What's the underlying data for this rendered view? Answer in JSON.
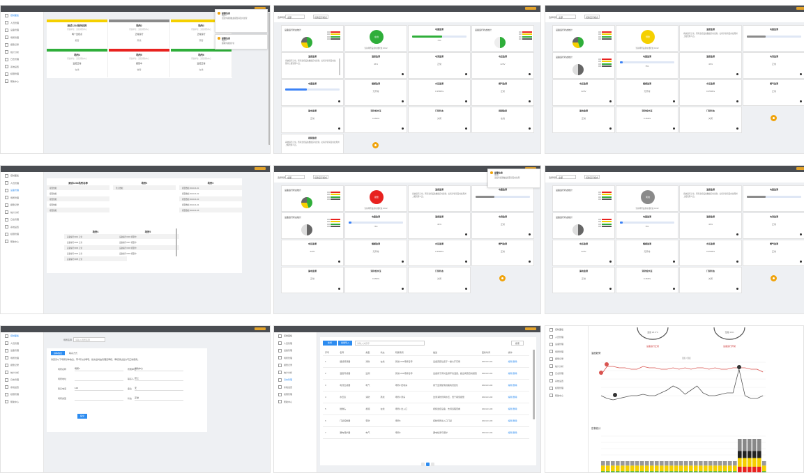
{
  "sidebar_items": [
    "控制面板",
    "人员管理",
    "设备管理",
    "场所管理",
    "报警记录",
    "统计分析",
    "日志管理",
    "系统设置",
    "权限管理",
    "帮助中心"
  ],
  "toolbar": {
    "filter_label": "选择场所",
    "filter_value": "全部",
    "filter_button": "切换显示模式"
  },
  "panel1": {
    "cards": [
      {
        "title": "测试1234场所名称",
        "status": "yellow",
        "sub": "所属单位：某某消防中心",
        "val1": "两个监控点",
        "val2": "报警"
      },
      {
        "title": "场所2",
        "status": "gray",
        "sub": "所属单位：某某消防中心",
        "val1": "正常运行",
        "val2": "离线"
      },
      {
        "title": "场所3",
        "status": "yellow",
        "sub": "所属单位：某某消防中心",
        "val1": "正常运行",
        "val2": "预警"
      },
      {
        "title": "场所4",
        "status": "green",
        "sub": "所属单位：某某消防中心",
        "val1": "监控正常",
        "val2": "在线"
      },
      {
        "title": "场所5",
        "status": "red",
        "sub": "所属单位：某某消防中心",
        "val1": "报警中",
        "val2": "告警"
      },
      {
        "title": "场所6",
        "status": "green",
        "sub": "所属单位：某某消防中心",
        "val1": "监控正常",
        "val2": "在线"
      }
    ],
    "notices": [
      {
        "title": "报警信息",
        "body": "场所1\n温度传感器触发报警请及时处理"
      },
      {
        "title": "报警信息",
        "body": "场所5\n烟雾传感器异常"
      }
    ]
  },
  "dash": {
    "pie_title": "设备运行状态统计",
    "legend": [
      "在线",
      "离线",
      "报警",
      "预警"
    ],
    "circle_label_green": "在线",
    "circle_label_yellow": "预警",
    "circle_label_red": "报警",
    "circle_label_gray": "离线",
    "circle_caption": "当前场所设备在线状态 10/12",
    "progress_title": "电量监测",
    "progress_val": "75%",
    "cells": [
      {
        "title": "温度监测",
        "val": "25.6°C"
      },
      {
        "title": "湿度监测",
        "val": "46%"
      },
      {
        "title": "电流监测",
        "val": "正常"
      },
      {
        "title": "电压监测",
        "val": "220V"
      },
      {
        "title": "烟感监测",
        "val": "无异常"
      },
      {
        "title": "水压监测",
        "val": "0.35MPa"
      },
      {
        "title": "燃气监测",
        "val": "正常"
      },
      {
        "title": "漏电监测",
        "val": "正常"
      },
      {
        "title": "消防栓水压",
        "val": "0.4MPa"
      },
      {
        "title": "门禁状态",
        "val": "关闭"
      },
      {
        "title": "视频监控",
        "val": "在线"
      }
    ],
    "desc": "系统运行正常，所有监控设备数据实时更新，如有异常请及时处理并上报管理人员。"
  },
  "panel4": {
    "cards": [
      {
        "title": "测试1234场所名称",
        "rows": [
          "报警数据",
          "报警数据",
          "报警数据",
          "报警数据",
          "报警数据"
        ]
      },
      {
        "title": "场所2",
        "rows": [
          "暂无数据"
        ]
      },
      {
        "title": "场所3",
        "rows": [
          "报警数据 2024-01-01",
          "报警数据 2024-01-02",
          "报警数据 2024-01-03",
          "报警数据 2024-01-04",
          "报警数据 2024-01-05"
        ]
      },
      {
        "title": "场所4",
        "rows": [
          "设备编号0001 正常",
          "设备编号0002 正常",
          "设备编号0003 正常",
          "设备编号0004 正常",
          "设备编号0005 正常"
        ]
      },
      {
        "title": "场所5",
        "rows": [
          "设备编号0006 报警中",
          "设备编号0007 报警中",
          "设备编号0008 报警中",
          "设备编号0009 报警中"
        ]
      }
    ]
  },
  "panel7": {
    "search_label": "场所名称",
    "search_placeholder": "请输入场所名称",
    "tabs": [
      "基本信息",
      "联系方式"
    ],
    "note": "请完善以下场所基本信息，带*号为必填项，提交后将由管理员审核，审核通过后方可正常使用。",
    "rows": [
      {
        "k": "场所名称",
        "v": "场所1",
        "k2": "所属单位",
        "v2": "消防中心"
      },
      {
        "k": "场所地址",
        "v": "",
        "k2": "联系人",
        "v2": "张三"
      },
      {
        "k": "联系电话",
        "v": "123",
        "k2": "备注",
        "v2": "无"
      },
      {
        "k": "场所类型",
        "v": "",
        "k2": "状态",
        "v2": "正常"
      }
    ],
    "submit": "提交"
  },
  "panel8": {
    "buttons": [
      "新增",
      "批量导入"
    ],
    "search_placeholder": "请输入关键字",
    "search_btn": "搜索",
    "headers": [
      "序号",
      "名称",
      "类型",
      "状态",
      "所属场所",
      "描述",
      "更新时间",
      "操作"
    ],
    "rows": [
      [
        "1",
        "烟感探测器",
        "消防",
        "在线",
        "测试1234场所名称",
        "设备安装位置于一楼大厅东侧",
        "2024-01-01",
        "编辑 删除"
      ],
      [
        "2",
        "温度传感器",
        "监测",
        "",
        "测试1234场所名称",
        "设备用于实时监测环境温度，超出阈值自动报警",
        "2024-01-01",
        "编辑 删除"
      ],
      [
        "3",
        "电流互感器",
        "电气",
        "",
        "场所2 配电房",
        "用于监测配电线路电流变化",
        "2024-01-02",
        "编辑 删除"
      ],
      [
        "4",
        "水压表",
        "消防",
        "离线",
        "场所3 泵房",
        "监测消防管网水压，低于阈值报警",
        "2024-01-02",
        "编辑 删除"
      ],
      [
        "5",
        "摄像头",
        "视频",
        "在线",
        "场所4 出入口",
        "视频监控设备，支持远程查看",
        "2024-01-03",
        "编辑 删除"
      ],
      [
        "6",
        "门禁控制器",
        "安防",
        "",
        "场所5",
        "控制场所出入口门禁",
        "2024-01-03",
        "编辑 删除"
      ],
      [
        "7",
        "漏电保护器",
        "电气",
        "",
        "场所6",
        "漏电检测与保护",
        "2024-01-04",
        "编辑 删除"
      ]
    ],
    "pages": [
      "1",
      "2",
      "3"
    ]
  },
  "panel9": {
    "gauge1": "温度 28.6°C",
    "gauge2": "湿度 46%",
    "gauge_cap1": "设备运行正常",
    "gauge_cap2": "设备运行异常",
    "line_title": "温度趋势",
    "line_legend": "温度 / 湿度",
    "bar_title": "告警统计"
  },
  "colors": {
    "green": "#2fae3a",
    "yellow": "#f5d000",
    "red": "#e8221f",
    "gray": "#8a8a8a",
    "blue": "#2d8cf0",
    "orange": "#f0a30a"
  }
}
